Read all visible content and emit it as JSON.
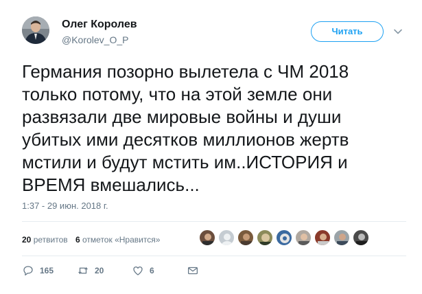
{
  "author": {
    "name": "Олег Королев",
    "handle": "@Korolev_O_P"
  },
  "follow_label": "Читать",
  "tweet": {
    "text": "Германия позорно вылетела с ЧМ 2018\nтолько потому, что на этой земле они\nразвязали две мировые войны и души\nубитых ими десятков миллионов жертв\nмстили и будут мстить им..ИСТОРИЯ и\nВРЕМЯ вмешались...",
    "timestamp": "1:37 - 29 июн. 2018 г."
  },
  "stats": {
    "retweets_count": "20",
    "retweets_label": "ретвитов",
    "likes_count": "6",
    "likes_label": "отметок «Нравится»"
  },
  "likers_count": 9,
  "actions": {
    "replies": "165",
    "retweets": "20",
    "likes": "6"
  },
  "colors": {
    "accent": "#1da1f2",
    "secondary_text": "#657786",
    "divider": "#e6ecf0"
  },
  "icons": [
    "chevron-down-icon",
    "reply-icon",
    "retweet-icon",
    "heart-icon",
    "dm-icon"
  ]
}
